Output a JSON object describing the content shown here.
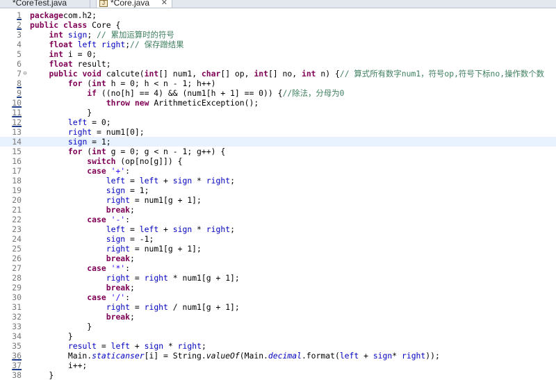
{
  "tabs": [
    {
      "label": "*CoreTest.java",
      "active": false
    },
    {
      "label": "*Core.java",
      "active": true,
      "close": "✕"
    }
  ],
  "colors": {
    "keyword": "#7f0055",
    "field": "#0000c0",
    "comment": "#3f7f5f",
    "string": "#2a00ff",
    "current_line": "#e8f2fe",
    "line_number": "#787878"
  },
  "editor": {
    "current_line": 14,
    "fold_marker_line": 7,
    "marked_lines": [
      1,
      2,
      8,
      9,
      10,
      11,
      12,
      36,
      37
    ],
    "lines": [
      [
        [
          "kw",
          "package"
        ],
        [
          "",
          "com.h2;"
        ]
      ],
      [
        [
          "kw",
          "public class"
        ],
        [
          "",
          " Core {"
        ]
      ],
      [
        [
          "",
          "    "
        ],
        [
          "kw",
          "int"
        ],
        [
          "",
          " "
        ],
        [
          "fld",
          "sign"
        ],
        [
          "",
          "; "
        ],
        [
          "cmt",
          "// 累加运算时的符号"
        ]
      ],
      [
        [
          "",
          "    "
        ],
        [
          "kw",
          "float"
        ],
        [
          "",
          " "
        ],
        [
          "fld",
          "left"
        ],
        [
          ", ",
          " "
        ],
        [
          "fld",
          "right"
        ],
        [
          "",
          ";"
        ],
        [
          "cmt",
          "// 保存蹭结果"
        ]
      ],
      [
        [
          "",
          "    "
        ],
        [
          "kw",
          "int"
        ],
        [
          "",
          " i = 0;"
        ]
      ],
      [
        [
          "",
          "    "
        ],
        [
          "kw",
          "float"
        ],
        [
          "",
          " result;"
        ]
      ],
      [
        [
          "",
          "    "
        ],
        [
          "kw",
          "public void"
        ],
        [
          "",
          " calcute("
        ],
        [
          "kw",
          "int"
        ],
        [
          "",
          "[] num1, "
        ],
        [
          "kw",
          "char"
        ],
        [
          "",
          "[] op, "
        ],
        [
          "kw",
          "int"
        ],
        [
          "",
          "[] no, "
        ],
        [
          "kw",
          "int"
        ],
        [
          "",
          " n) {"
        ],
        [
          "cmt",
          "// 算式所有数字num1，符号op,符号下标no,操作数个数"
        ]
      ],
      [
        [
          "",
          "        "
        ],
        [
          "kw",
          "for"
        ],
        [
          "",
          " ("
        ],
        [
          "kw",
          "int"
        ],
        [
          "",
          " h = 0; h < n - 1; h++)"
        ]
      ],
      [
        [
          "",
          "            "
        ],
        [
          "kw",
          "if"
        ],
        [
          "",
          " ((no[h] == 4) && (num1[h + 1] == 0)) {"
        ],
        [
          "cmt",
          "//除法，分母为0"
        ]
      ],
      [
        [
          "",
          "                "
        ],
        [
          "kw",
          "throw new"
        ],
        [
          "",
          " ArithmeticException();"
        ]
      ],
      [
        [
          "",
          "            }"
        ]
      ],
      [
        [
          "",
          "        "
        ],
        [
          "fld",
          "left"
        ],
        [
          "",
          " = 0;"
        ]
      ],
      [
        [
          "",
          "        "
        ],
        [
          "fld",
          "right"
        ],
        [
          "",
          " = num1[0];"
        ]
      ],
      [
        [
          "",
          "        "
        ],
        [
          "fld",
          "sign"
        ],
        [
          "",
          " = 1;"
        ]
      ],
      [
        [
          "",
          "        "
        ],
        [
          "kw",
          "for"
        ],
        [
          "",
          " ("
        ],
        [
          "kw",
          "int"
        ],
        [
          "",
          " g = 0; g < n - 1; g++) {"
        ]
      ],
      [
        [
          "",
          "            "
        ],
        [
          "kw",
          "switch"
        ],
        [
          "",
          " (op[no[g]]) {"
        ]
      ],
      [
        [
          "",
          "            "
        ],
        [
          "kw",
          "case"
        ],
        [
          "",
          " "
        ],
        [
          "str",
          "'+'"
        ],
        [
          "",
          ":"
        ]
      ],
      [
        [
          "",
          "                "
        ],
        [
          "fld",
          "left"
        ],
        [
          "",
          " = "
        ],
        [
          "fld",
          "left"
        ],
        [
          "",
          " + "
        ],
        [
          "fld",
          "sign"
        ],
        [
          "",
          " * "
        ],
        [
          "fld",
          "right"
        ],
        [
          "",
          ";"
        ]
      ],
      [
        [
          "",
          "                "
        ],
        [
          "fld",
          "sign"
        ],
        [
          "",
          " = 1;"
        ]
      ],
      [
        [
          "",
          "                "
        ],
        [
          "fld",
          "right"
        ],
        [
          "",
          " = num1[g + 1];"
        ]
      ],
      [
        [
          "",
          "                "
        ],
        [
          "kw",
          "break"
        ],
        [
          "",
          ";"
        ]
      ],
      [
        [
          "",
          "            "
        ],
        [
          "kw",
          "case"
        ],
        [
          "",
          " "
        ],
        [
          "str",
          "'-'"
        ],
        [
          "",
          ":"
        ]
      ],
      [
        [
          "",
          "                "
        ],
        [
          "fld",
          "left"
        ],
        [
          "",
          " = "
        ],
        [
          "fld",
          "left"
        ],
        [
          "",
          " + "
        ],
        [
          "fld",
          "sign"
        ],
        [
          "",
          " * "
        ],
        [
          "fld",
          "right"
        ],
        [
          "",
          ";"
        ]
      ],
      [
        [
          "",
          "                "
        ],
        [
          "fld",
          "sign"
        ],
        [
          "",
          " = -1;"
        ]
      ],
      [
        [
          "",
          "                "
        ],
        [
          "fld",
          "right"
        ],
        [
          "",
          " = num1[g + 1];"
        ]
      ],
      [
        [
          "",
          "                "
        ],
        [
          "kw",
          "break"
        ],
        [
          "",
          ";"
        ]
      ],
      [
        [
          "",
          "            "
        ],
        [
          "kw",
          "case"
        ],
        [
          "",
          " "
        ],
        [
          "str",
          "'*'"
        ],
        [
          "",
          ":"
        ]
      ],
      [
        [
          "",
          "                "
        ],
        [
          "fld",
          "right"
        ],
        [
          "",
          " = "
        ],
        [
          "fld",
          "right"
        ],
        [
          "",
          " * num1[g + 1];"
        ]
      ],
      [
        [
          "",
          "                "
        ],
        [
          "kw",
          "break"
        ],
        [
          "",
          ";"
        ]
      ],
      [
        [
          "",
          "            "
        ],
        [
          "kw",
          "case"
        ],
        [
          "",
          " "
        ],
        [
          "str",
          "'/'"
        ],
        [
          "",
          ":"
        ]
      ],
      [
        [
          "",
          "                "
        ],
        [
          "fld",
          "right"
        ],
        [
          "",
          " = "
        ],
        [
          "fld",
          "right"
        ],
        [
          "",
          " / num1[g + 1];"
        ]
      ],
      [
        [
          "",
          "                "
        ],
        [
          "kw",
          "break"
        ],
        [
          "",
          ";"
        ]
      ],
      [
        [
          "",
          "            }"
        ]
      ],
      [
        [
          "",
          "        }"
        ]
      ],
      [
        [
          "",
          "        "
        ],
        [
          "fld",
          "result"
        ],
        [
          "",
          " = "
        ],
        [
          "fld",
          "left"
        ],
        [
          "",
          " + "
        ],
        [
          "fld",
          "sign"
        ],
        [
          "",
          " * "
        ],
        [
          "fld",
          "right"
        ],
        [
          "",
          ";"
        ]
      ],
      [
        [
          "",
          "        Main."
        ],
        [
          "fldi",
          "staticanser"
        ],
        [
          "",
          "[i] = String."
        ],
        [
          "ital",
          "valueOf"
        ],
        [
          "",
          "(Main."
        ],
        [
          "fldi",
          "decimal"
        ],
        [
          "",
          ".format("
        ],
        [
          "fld",
          "left"
        ],
        [
          "",
          " + "
        ],
        [
          "fld",
          "sign"
        ],
        [
          "",
          "* "
        ],
        [
          "fld",
          "right"
        ],
        [
          "",
          "));"
        ]
      ],
      [
        [
          "",
          "        i++;"
        ]
      ],
      [
        [
          "",
          "    }"
        ]
      ]
    ]
  }
}
